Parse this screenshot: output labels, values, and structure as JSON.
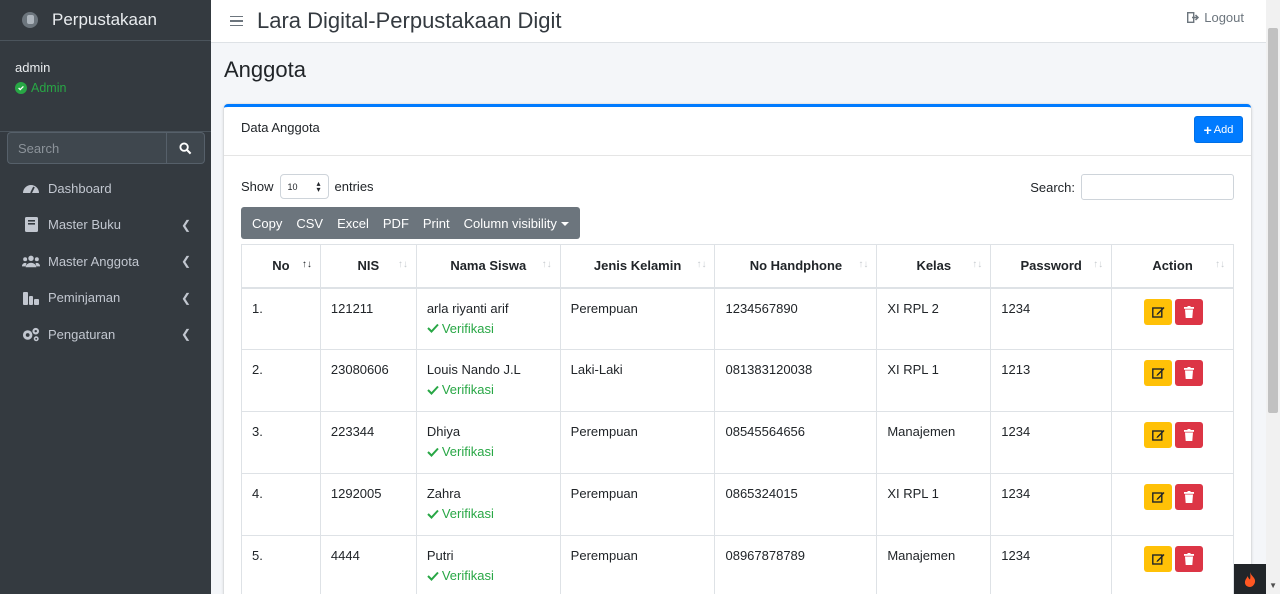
{
  "brand": {
    "name": "Perpustakaan"
  },
  "user": {
    "name": "admin",
    "role": "Admin"
  },
  "sidebar_search": {
    "placeholder": "Search"
  },
  "nav": [
    {
      "label": "Dashboard",
      "icon": "tachometer-icon",
      "has_children": false
    },
    {
      "label": "Master Buku",
      "icon": "book-icon",
      "has_children": true
    },
    {
      "label": "Master Anggota",
      "icon": "users-icon",
      "has_children": true
    },
    {
      "label": "Peminjaman",
      "icon": "book-exchange-icon",
      "has_children": true
    },
    {
      "label": "Pengaturan",
      "icon": "cogs-icon",
      "has_children": true
    }
  ],
  "header": {
    "title": "Lara Digital-Perpustakaan Digit",
    "logout": "Logout"
  },
  "page": {
    "title": "Anggota"
  },
  "card": {
    "title": "Data Anggota",
    "add_label": "Add"
  },
  "datatable": {
    "show_label": "Show",
    "entries_label": "entries",
    "page_length": "10",
    "search_label": "Search:",
    "buttons": [
      "Copy",
      "CSV",
      "Excel",
      "PDF",
      "Print",
      "Column visibility"
    ],
    "columns": [
      "No",
      "NIS",
      "Nama Siswa",
      "Jenis Kelamin",
      "No Handphone",
      "Kelas",
      "Password",
      "Action"
    ],
    "rows": [
      {
        "no": "1.",
        "nis": "121211",
        "nama": "arla riyanti arif",
        "status": "Verifikasi",
        "jk": "Perempuan",
        "hp": "1234567890",
        "kelas": "XI RPL 2",
        "password": "1234"
      },
      {
        "no": "2.",
        "nis": "23080606",
        "nama": "Louis Nando J.L",
        "status": "Verifikasi",
        "jk": "Laki-Laki",
        "hp": "081383120038",
        "kelas": "XI RPL 1",
        "password": "1213"
      },
      {
        "no": "3.",
        "nis": "223344",
        "nama": "Dhiya",
        "status": "Verifikasi",
        "jk": "Perempuan",
        "hp": "08545564656",
        "kelas": "Manajemen",
        "password": "1234"
      },
      {
        "no": "4.",
        "nis": "1292005",
        "nama": "Zahra",
        "status": "Verifikasi",
        "jk": "Perempuan",
        "hp": "0865324015",
        "kelas": "XI RPL 1",
        "password": "1234"
      },
      {
        "no": "5.",
        "nis": "4444",
        "nama": "Putri",
        "status": "Verifikasi",
        "jk": "Perempuan",
        "hp": "08967878789",
        "kelas": "Manajemen",
        "password": "1234"
      }
    ]
  },
  "colors": {
    "primary": "#007bff",
    "sidebar_bg": "#343a40",
    "success": "#28a745",
    "warning": "#ffc107",
    "danger": "#dc3545"
  }
}
